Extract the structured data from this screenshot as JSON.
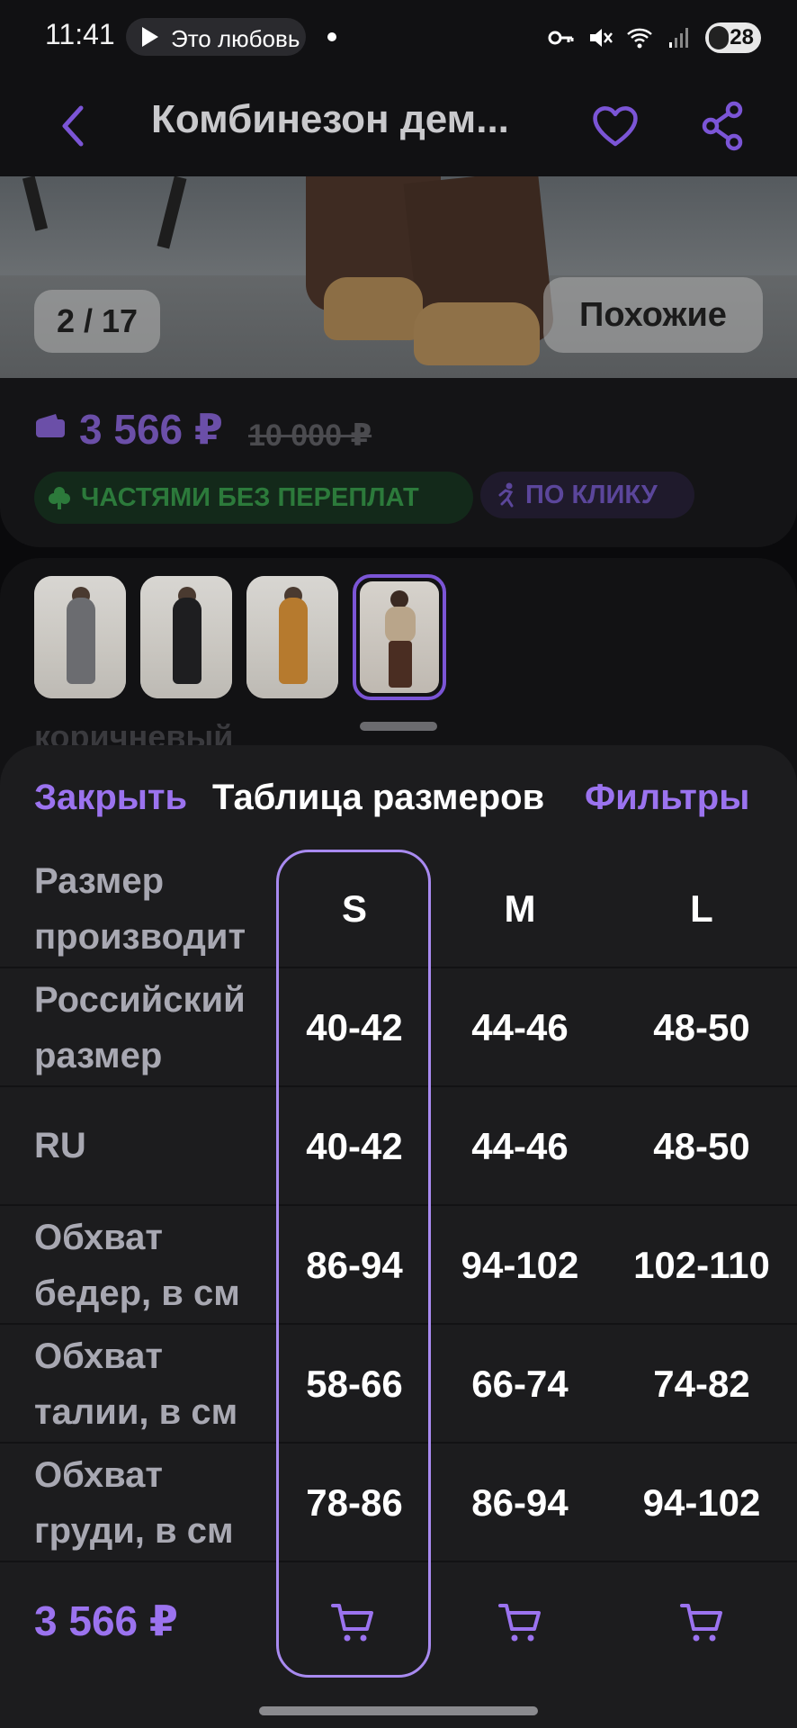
{
  "status_bar": {
    "time": "11:41",
    "music": "Это любовь",
    "battery": "28"
  },
  "header": {
    "title": "Комбинезон дем...",
    "icons": [
      "back-chevron-icon",
      "heart-icon",
      "share-icon"
    ]
  },
  "gallery": {
    "counter": "2 / 17",
    "similar_label": "Похожие"
  },
  "price": {
    "current": "3 566 ₽",
    "old": "10 000 ₽",
    "badge_split": "ЧАСТЯМИ БЕЗ ПЕРЕПЛАТ",
    "badge_click": "ПО КЛИКУ"
  },
  "colors": {
    "selected_name": "коричневый",
    "variants": [
      "серый",
      "чёрный",
      "бежевый",
      "коричневый"
    ]
  },
  "size_sheet": {
    "close_label": "Закрыть",
    "title": "Таблица размеров",
    "filters_label": "Фильтры",
    "header_label": "Размер производит",
    "sizes": [
      "S",
      "M",
      "L"
    ],
    "selected_size": "S",
    "rows": [
      {
        "label": "Российский размер",
        "values": [
          "40-42",
          "44-46",
          "48-50"
        ]
      },
      {
        "label": "RU",
        "values": [
          "40-42",
          "44-46",
          "48-50"
        ]
      },
      {
        "label": "Обхват бедер, в см",
        "values": [
          "86-94",
          "94-102",
          "102-110"
        ]
      },
      {
        "label": "Обхват талии, в см",
        "values": [
          "58-66",
          "66-74",
          "74-82"
        ]
      },
      {
        "label": "Обхват груди, в см",
        "values": [
          "78-86",
          "86-94",
          "94-102"
        ]
      }
    ],
    "footer_price": "3 566 ₽"
  },
  "colors_theme": {
    "accent": "#9b73ef",
    "background": "#0a0a0c",
    "sheet": "#1c1c1e",
    "green_badge": "#2c7a3b"
  }
}
